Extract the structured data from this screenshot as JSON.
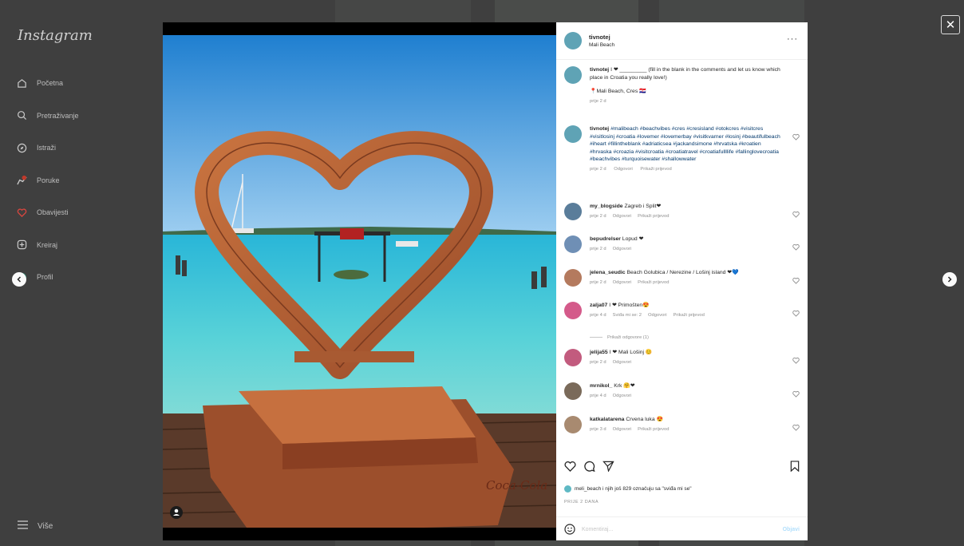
{
  "app": {
    "logo": "Instagram"
  },
  "sidebar": {
    "items": [
      {
        "label": "Početna",
        "icon": "home-icon"
      },
      {
        "label": "Pretraživanje",
        "icon": "search-icon"
      },
      {
        "label": "Istraži",
        "icon": "compass-icon"
      },
      {
        "label": "Poruke",
        "icon": "messenger-icon"
      },
      {
        "label": "Obavijesti",
        "icon": "heart-icon"
      },
      {
        "label": "Kreiraj",
        "icon": "plus-square-icon"
      },
      {
        "label": "Profil",
        "icon": "avatar-icon"
      }
    ],
    "more_label": "Više"
  },
  "post": {
    "username": "tivnotej",
    "location": "Mali Beach",
    "sign_text": "Coca-Cola",
    "caption": {
      "username": "tivnotej",
      "text": "I ❤ _________ (fill in the blank in the comments and let us know which place in Croatia you really love!)",
      "location_line": "📍Mali Beach, Cres 🇭🇷",
      "time": "prije 2 d"
    },
    "hashtags": {
      "username": "tivnotej",
      "text": "#malibeach #beachvibes #cres #cresisland #otokcres #visitcres #visitlosinj #croatia #lovemer #lovemerbay #visitkvarner #losinj #beautifulbeach #iheart #fillintheblank #adriaticsea #jackandsimone #hrvatska #kroatien #hrvaska #croazia #visitcroatia #croatiatravel #croatiafullllife #fallinglovecroatia #beachvibes #turquoisewater #shallowwater",
      "meta": [
        "prije 2 d",
        "Odgovori",
        "Prikaži prijevod"
      ]
    },
    "comments": [
      {
        "username": "my_blogside",
        "text": "Zagreb i Split❤",
        "meta": [
          "prije 2 d",
          "Odgovori",
          "Prikaži prijevod"
        ],
        "avatar_color": "#5a7d9a"
      },
      {
        "username": "bepudrelser",
        "text": "Lopud ❤",
        "meta": [
          "prije 2 d",
          "Odgovori"
        ],
        "avatar_color": "#6f8fb5"
      },
      {
        "username": "jelena_seudic",
        "text": "Beach Golubica / Nerezine / Lošinj island ❤💙",
        "meta": [
          "prije 2 d",
          "Odgovori",
          "Prikaži prijevod"
        ],
        "avatar_color": "#b47a5e"
      },
      {
        "username": "zalja07",
        "text": "I ❤ Primošten😍",
        "meta": [
          "prije 4 d",
          "Sviđa mi se: 2",
          "Odgovori",
          "Prikaži prijevod"
        ],
        "avatar_color": "#d45a8a"
      },
      {
        "username": "jelija55",
        "text": "I ❤ Mali Lošinj 😊",
        "meta": [
          "prije 2 d",
          "Odgovori"
        ],
        "avatar_color": "#c25b7e"
      },
      {
        "username": "mrnikol_",
        "text": "Krk 🤗❤",
        "meta": [
          "prije 4 d",
          "Odgovori"
        ],
        "avatar_color": "#7a6a5a"
      },
      {
        "username": "katkalatarena",
        "text": "Crvena luka 😍",
        "meta": [
          "prije 3 d",
          "Odgovori",
          "Prikaži prijevod"
        ],
        "avatar_color": "#a88a70"
      }
    ],
    "view_replies": "Prikaži odgovore (1)",
    "likes_text": "meli_beach i njih još 829 označuju sa \"sviđa mi se\"",
    "likes_user": "meli_beach",
    "date": "PRIJE 2 DANA",
    "comment_placeholder": "Komentiraj...",
    "post_button": "Objavi"
  },
  "colors": {
    "accent": "#0095f6",
    "heart": "#ed4956"
  }
}
